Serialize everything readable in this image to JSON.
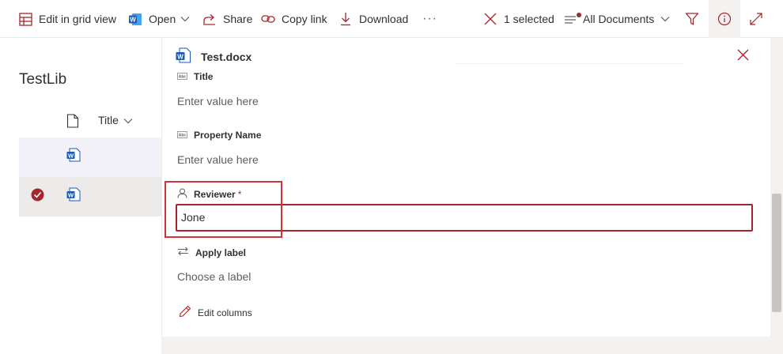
{
  "command_bar": {
    "edit_grid_label": "Edit in grid view",
    "open_label": "Open",
    "share_label": "Share",
    "copy_link_label": "Copy link",
    "download_label": "Download",
    "more_label": "···",
    "selected_label": "1 selected",
    "view_label": "All Documents"
  },
  "library": {
    "title": "TestLib",
    "column_title": "Title"
  },
  "details": {
    "file_name": "Test.docx",
    "fields": {
      "title_label": "Title",
      "title_value": "Enter value here",
      "property_label": "Property Name",
      "property_value": "Enter value here",
      "reviewer_label": "Reviewer",
      "reviewer_required": "*",
      "reviewer_value": "Jone",
      "apply_label_label": "Apply label",
      "apply_label_value": "Choose a label"
    },
    "edit_columns_label": "Edit columns"
  },
  "colors": {
    "accent": "#a4262c",
    "highlight_box": "#d13438",
    "word_blue": "#185abd"
  }
}
